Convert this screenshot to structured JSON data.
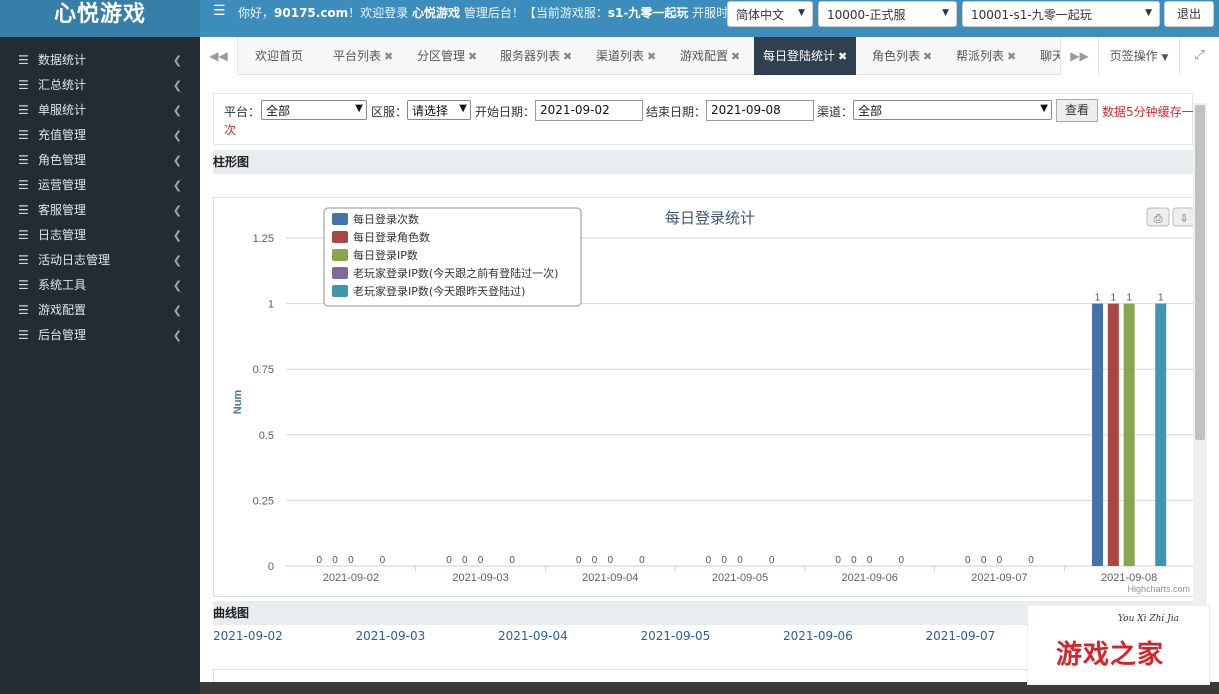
{
  "header": {
    "logo_text": "心悦游戏",
    "welcome_pre": "你好，",
    "welcome_user": "90175.com",
    "welcome_mid": "！欢迎登录 ",
    "welcome_brand": "心悦游戏",
    "welcome_tail": " 管理后台！【当前游戏服：",
    "welcome_server": "s1-九零一起玩",
    "welcome_end": " 开服时间",
    "lang_select": "简体中文",
    "platform_select": "10000-正式服",
    "server_select": "10001-s1-九零一起玩",
    "logout_label": "退出"
  },
  "sidebar": {
    "items": [
      {
        "label": "数据统计"
      },
      {
        "label": "汇总统计"
      },
      {
        "label": "单服统计"
      },
      {
        "label": "充值管理"
      },
      {
        "label": "角色管理"
      },
      {
        "label": "运营管理"
      },
      {
        "label": "客服管理"
      },
      {
        "label": "日志管理"
      },
      {
        "label": "活动日志管理"
      },
      {
        "label": "系统工具"
      },
      {
        "label": "游戏配置"
      },
      {
        "label": "后台管理"
      }
    ]
  },
  "tabs": {
    "items": [
      {
        "label": "欢迎首页"
      },
      {
        "label": "平台列表"
      },
      {
        "label": "分区管理"
      },
      {
        "label": "服务器列表"
      },
      {
        "label": "渠道列表"
      },
      {
        "label": "游戏配置"
      },
      {
        "label": "每日登陆统计"
      },
      {
        "label": "角色列表"
      },
      {
        "label": "帮派列表"
      },
      {
        "label": "聊天"
      }
    ],
    "ops_label": "页签操作"
  },
  "filter": {
    "platform_label": "平台：",
    "platform_value": "全部",
    "zone_label": "区服：",
    "zone_value": "请选择",
    "start_label": "开始日期：",
    "start_value": "2021-09-02",
    "end_label": "结束日期：",
    "end_value": "2021-09-08",
    "channel_label": "渠道：",
    "channel_value": "全部",
    "query_button": "查看",
    "cache_note_1": "数据5分钟缓存一",
    "cache_note_2": "次"
  },
  "sections": {
    "bar_title": "柱形图",
    "line_title": "曲线图"
  },
  "chart_data": {
    "type": "bar",
    "title": "每日登录统计",
    "ylabel": "Num",
    "xlabel": "",
    "ylim": [
      0,
      1.25
    ],
    "yticks": [
      "0",
      "0.25",
      "0.5",
      "0.75",
      "1",
      "1.25"
    ],
    "credit": "Highcharts.com",
    "legend_position": "top-left",
    "categories": [
      "2021-09-02",
      "2021-09-03",
      "2021-09-04",
      "2021-09-05",
      "2021-09-06",
      "2021-09-07",
      "2021-09-08"
    ],
    "series": [
      {
        "name": "每日登录次数",
        "color": "#4572a7",
        "values": [
          0,
          0,
          0,
          0,
          0,
          0,
          1
        ]
      },
      {
        "name": "每日登录角色数",
        "color": "#aa4643",
        "values": [
          0,
          0,
          0,
          0,
          0,
          0,
          1
        ]
      },
      {
        "name": "每日登录IP数",
        "color": "#89a54e",
        "values": [
          0,
          0,
          0,
          0,
          0,
          0,
          1
        ]
      },
      {
        "name": "老玩家登录IP数(今天跟之前有登陆过一次)",
        "color": "#80699b",
        "values": [
          null,
          null,
          null,
          null,
          null,
          null,
          null
        ]
      },
      {
        "name": "老玩家登录IP数(今天跟昨天登陆过)",
        "color": "#3d96ae",
        "values": [
          0,
          0,
          0,
          0,
          0,
          0,
          1
        ]
      }
    ]
  },
  "line_dates": [
    "2021-09-02",
    "2021-09-03",
    "2021-09-04",
    "2021-09-05",
    "2021-09-06",
    "2021-09-07"
  ],
  "watermark": {
    "small": "You Xi Zhi Jia",
    "big": "游戏之家"
  }
}
